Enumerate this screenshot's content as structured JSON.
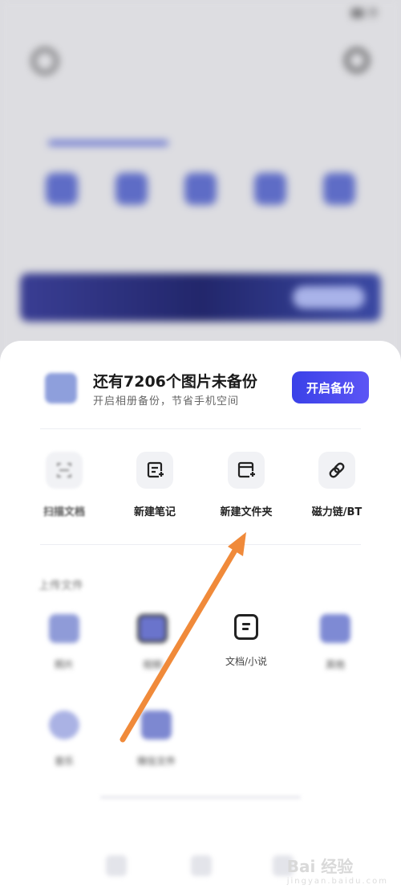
{
  "backup": {
    "title": "还有7206个图片未备份",
    "subtitle": "开启相册备份，节省手机空间",
    "button_label": "开启备份"
  },
  "actions": [
    {
      "label": "扫描文档",
      "icon": "scan-icon"
    },
    {
      "label": "新建笔记",
      "icon": "new-note-icon"
    },
    {
      "label": "新建文件夹",
      "icon": "new-folder-icon"
    },
    {
      "label": "磁力链/BT",
      "icon": "link-icon"
    }
  ],
  "upload": {
    "section_label": "上传文件",
    "items": [
      {
        "label": "照片",
        "icon": "photo-icon"
      },
      {
        "label": "视频",
        "icon": "video-icon"
      },
      {
        "label": "文档/小说",
        "icon": "document-icon"
      },
      {
        "label": "其他",
        "icon": "other-file-icon"
      },
      {
        "label": "音乐",
        "icon": "music-icon"
      },
      {
        "label": "微信文件",
        "icon": "wechat-file-icon"
      }
    ]
  },
  "watermark": {
    "text": "Bai 经验",
    "sub": "jingyan.baidu.com"
  },
  "colors": {
    "accent": "#4744ee",
    "arrow": "#f08a3a"
  }
}
